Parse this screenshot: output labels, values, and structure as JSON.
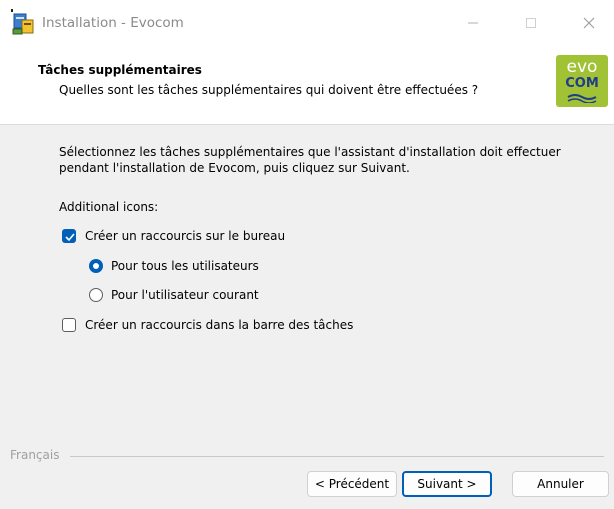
{
  "window": {
    "title": "Installation - Evocom",
    "minimize_glyph": "—",
    "maximize_glyph": "☐",
    "close_glyph": "✕"
  },
  "header": {
    "title": "Tâches supplémentaires",
    "subtitle": "Quelles sont les tâches supplémentaires qui doivent être effectuées ?",
    "logo": {
      "line1": "evo",
      "line2": "COM",
      "color": "#a2c236",
      "accent": "#1f3d8a"
    }
  },
  "main": {
    "instructions": "Sélectionnez les tâches supplémentaires que l'assistant d'installation doit effectuer pendant l'installation de Evocom, puis cliquez sur Suivant.",
    "section_label": "Additional icons:",
    "tasks": [
      {
        "label": "Créer un raccourcis sur le bureau",
        "checked": true
      },
      {
        "label": "Pour tous les utilisateurs",
        "selected": true
      },
      {
        "label": "Pour l'utilisateur courant",
        "selected": false
      },
      {
        "label": "Créer un raccourcis dans la barre des tâches",
        "checked": false
      }
    ]
  },
  "footer": {
    "language": "Français",
    "back_label": "< Précédent",
    "next_label": "Suivant >",
    "cancel_label": "Annuler"
  },
  "colors": {
    "accent": "#005fb8",
    "content_bg": "#f0f0f0"
  }
}
